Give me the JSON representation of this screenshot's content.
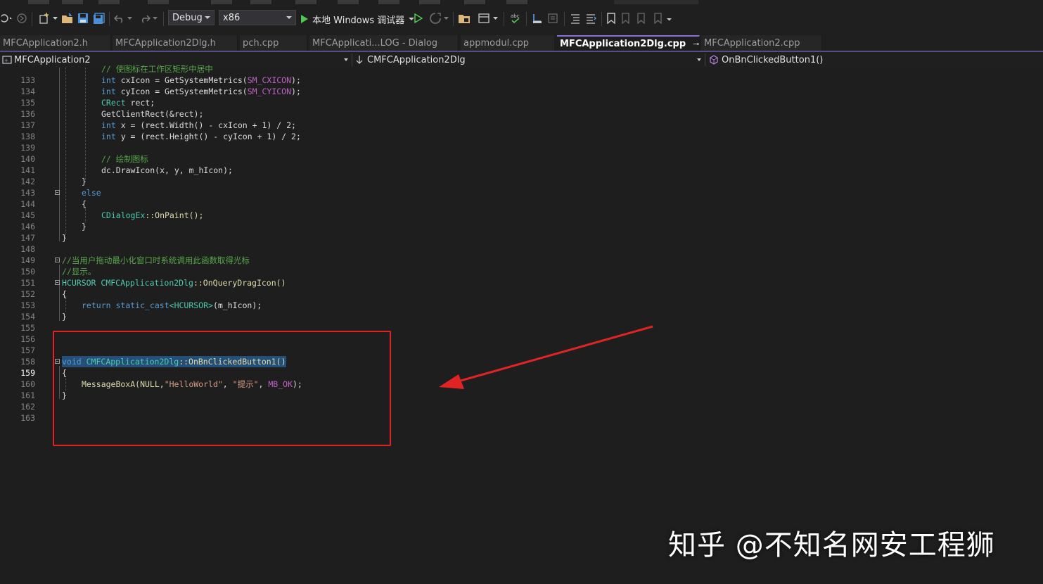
{
  "toolbar": {
    "config": "Debug",
    "platform": "x86",
    "run_label": "本地 Windows 调试器"
  },
  "tabs": [
    {
      "label": "MFCApplication2.h"
    },
    {
      "label": "MFCApplication2Dlg.h"
    },
    {
      "label": "pch.cpp"
    },
    {
      "label": "MFCApplicati...LOG - Dialog"
    },
    {
      "label": "appmodul.cpp"
    },
    {
      "label": "MFCApplication2Dlg.cpp"
    },
    {
      "label": "MFCApplication2.cpp"
    }
  ],
  "tab_pin_glyph": "⊸",
  "tab_close_glyph": "✕",
  "navbar": {
    "project": "MFCApplication2",
    "class": "CMFCApplication2Dlg",
    "member": "OnBnClickedButton1()"
  },
  "line_numbers": [
    "133",
    "134",
    "135",
    "136",
    "137",
    "138",
    "139",
    "140",
    "141",
    "142",
    "143",
    "144",
    "145",
    "146",
    "147",
    "148",
    "149",
    "150",
    "151",
    "152",
    "153",
    "154",
    "155",
    "156",
    "157",
    "158",
    "159",
    "160",
    "161",
    "162",
    "163"
  ],
  "current_line": "159",
  "code": {
    "l133": "// 使图标在工作区矩形中居中",
    "l134_kw": "int",
    "l134_rest": " cxIcon = GetSystemMetrics(",
    "l134_mac": "SM_CXICON",
    "l134_end": ");",
    "l135_kw": "int",
    "l135_rest": " cyIcon = GetSystemMetrics(",
    "l135_mac": "SM_CYICON",
    "l135_end": ");",
    "l136_ty": "CRect",
    "l136_rest": " rect;",
    "l137": "GetClientRect(&rect);",
    "l138_kw": "int",
    "l138_rest": " x = (rect.Width() - cxIcon + 1) / 2;",
    "l139_kw": "int",
    "l139_rest": " y = (rect.Height() - cyIcon + 1) / 2;",
    "l141": "// 绘制图标",
    "l142": "dc.DrawIcon(x, y, m_hIcon);",
    "l143": "}",
    "l144": "else",
    "l145": "{",
    "l146_ty": "CDialogEx",
    "l146_rest": "::OnPaint();",
    "l147": "}",
    "l148": "}",
    "l150": "//当用户拖动最小化窗口时系统调用此函数取得光标",
    "l151": "//显示。",
    "l152_ty": "HCURSOR",
    "l152_cls": " CMFCApplication2Dlg",
    "l152_rest": "::OnQueryDragIcon()",
    "l153": "{",
    "l154_kw": "return",
    "l154_kw2": " static_cast",
    "l154_ty": "<HCURSOR>",
    "l154_rest": "(m_hIcon);",
    "l155": "}",
    "l159_kw": "void",
    "l159_cls": " CMFCApplication2Dlg",
    "l159_rest": "::OnBnClickedButton1()",
    "l160": "{",
    "l161_fn": "MessageBoxA(NULL,",
    "l161_s1": "\"HelloWorld\"",
    "l161_c1": ", ",
    "l161_s2": "\"提示\"",
    "l161_c2": ", ",
    "l161_mac": "MB_OK",
    "l161_end": ");",
    "l162": "}"
  },
  "annotation_color": "#e02424",
  "watermark": "知乎 @不知名网安工程狮"
}
